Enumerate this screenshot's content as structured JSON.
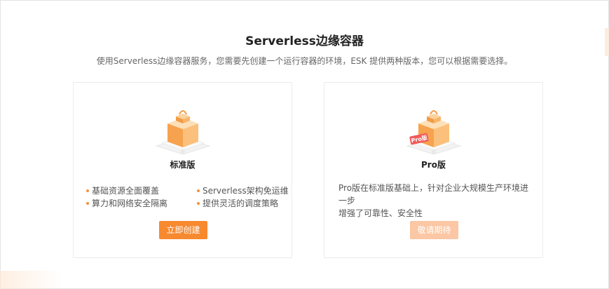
{
  "header": {
    "title": "Serverless边缘容器",
    "subtitle": "使用Serverless边缘容器服务，您需要先创建一个运行容器的环境，ESK 提供两种版本，您可以根据需要选择。"
  },
  "standard": {
    "title": "标准版",
    "features": [
      "基础资源全面覆盖",
      "Serverless架构免运维",
      "算力和网络安全隔离",
      "提供灵活的调度策略"
    ],
    "button_label": "立即创建"
  },
  "pro": {
    "title": "Pro版",
    "badge": "Pro版",
    "description_line1": "Pro版在标准版基础上，针对企业大规模生产环境进一步",
    "description_line2": "增强了可靠性、安全性",
    "button_label": "敬请期待"
  },
  "colors": {
    "accent": "#f7892f",
    "accent_disabled": "#fbc7a4",
    "bullet": "#f7913d"
  },
  "icons": {
    "standard_illustration": "cube-box-illustration",
    "pro_illustration": "cube-box-pro-illustration"
  }
}
